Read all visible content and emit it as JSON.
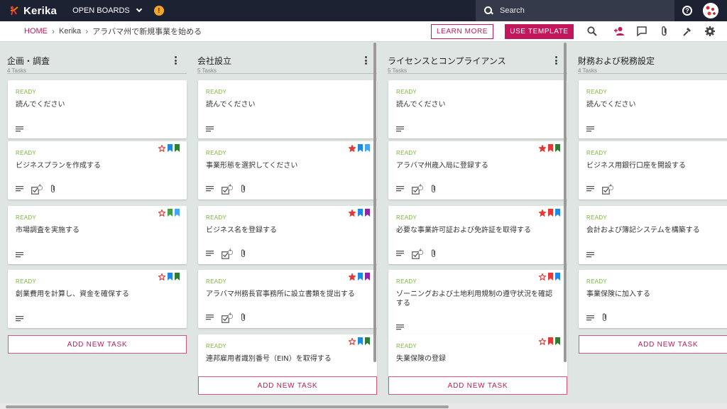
{
  "app": {
    "name": "Kerika",
    "open_boards": "OPEN BOARDS",
    "notice": "!"
  },
  "search": {
    "placeholder": "Search"
  },
  "help": {
    "label": "?"
  },
  "breadcrumb": {
    "home": "HOME",
    "org": "Kerika",
    "board": "アラバマ州で新規事業を始める"
  },
  "buttons": {
    "learn_more": "LEARN MORE",
    "use_template": "USE TEMPLATE"
  },
  "colors": {
    "accent": "#c2185b",
    "ready": "#7cb342",
    "star": "#e53935",
    "blue": "#1e88e5",
    "green": "#2e7d32",
    "purple": "#8e24aa",
    "red": "#e53935",
    "lightblue": "#42a5f5"
  },
  "add_task_label": "ADD NEW TASK",
  "columns": [
    {
      "title": "企画・調査",
      "count": "4 Tasks",
      "cards": [
        {
          "status": "READY",
          "title": "読んでください",
          "star": "none",
          "tags": [],
          "checklist": "",
          "attach": false
        },
        {
          "status": "READY",
          "title": "ビジネスプランを作成する",
          "star": "outline",
          "tags": [
            "#1e88e5",
            "#2e7d32"
          ],
          "checklist": "4",
          "attach": true
        },
        {
          "status": "READY",
          "title": "市場調査を実施する",
          "star": "outline",
          "tags": [
            "#43a047",
            "#42a5f5"
          ],
          "checklist": "",
          "attach": false
        },
        {
          "status": "READY",
          "title": "創業費用を計算し、資金を確保する",
          "star": "outline",
          "tags": [
            "#1e88e5",
            "#2e7d32"
          ],
          "checklist": "",
          "attach": false
        }
      ]
    },
    {
      "title": "会社設立",
      "count": "5 Tasks",
      "cards": [
        {
          "status": "READY",
          "title": "読んでください",
          "star": "none",
          "tags": [],
          "checklist": "",
          "attach": false
        },
        {
          "status": "READY",
          "title": "事業形態を選択してください",
          "star": "filled",
          "tags": [
            "#1e88e5",
            "#42a5f5"
          ],
          "checklist": "4",
          "attach": true
        },
        {
          "status": "READY",
          "title": "ビジネス名を登録する",
          "star": "filled",
          "tags": [
            "#1e88e5",
            "#8e24aa"
          ],
          "checklist": "4",
          "attach": true
        },
        {
          "status": "READY",
          "title": "アラバマ州務長官事務所に設立書類を提出する",
          "star": "filled",
          "tags": [
            "#1e88e5",
            "#8e24aa"
          ],
          "checklist": "4",
          "attach": true
        },
        {
          "status": "READY",
          "title": "連邦雇用者識別番号（EIN）を取得する",
          "star": "outline",
          "tags": [
            "#1e88e5",
            "#2e7d32"
          ],
          "checklist": "",
          "attach": false
        }
      ]
    },
    {
      "title": "ライセンスとコンプライアンス",
      "count": "5 Tasks",
      "cards": [
        {
          "status": "READY",
          "title": "読んでください",
          "star": "none",
          "tags": [],
          "checklist": "",
          "attach": false
        },
        {
          "status": "READY",
          "title": "アラバマ州歳入局に登録する",
          "star": "filled",
          "tags": [
            "#e53935",
            "#2e7d32"
          ],
          "checklist": "4",
          "attach": true
        },
        {
          "status": "READY",
          "title": "必要な事業許可証および免許証を取得する",
          "star": "filled",
          "tags": [
            "#e53935",
            "#1e88e5"
          ],
          "checklist": "4",
          "attach": true
        },
        {
          "status": "READY",
          "title": "ゾーニングおよび土地利用規制の遵守状況を確認する",
          "star": "outline",
          "tags": [
            "#e53935",
            "#1e88e5"
          ],
          "checklist": "",
          "attach": false
        },
        {
          "status": "READY",
          "title": "失業保険の登録",
          "star": "outline",
          "tags": [
            "#e53935",
            "#2e7d32"
          ],
          "checklist": "",
          "attach": false
        }
      ]
    },
    {
      "title": "財務および税務設定",
      "count": "4 Tasks",
      "cards": [
        {
          "status": "READY",
          "title": "読んでください",
          "star": "none",
          "tags": [],
          "checklist": "",
          "attach": false
        },
        {
          "status": "READY",
          "title": "ビジネス用銀行口座を開設する",
          "star": "none",
          "tags": [],
          "checklist": "4",
          "attach": false
        },
        {
          "status": "READY",
          "title": "会計および簿記システムを構築する",
          "star": "none",
          "tags": [],
          "checklist": "",
          "attach": false
        },
        {
          "status": "READY",
          "title": "事業保険に加入する",
          "star": "none",
          "tags": [],
          "checklist": "",
          "attach": true
        }
      ]
    }
  ]
}
